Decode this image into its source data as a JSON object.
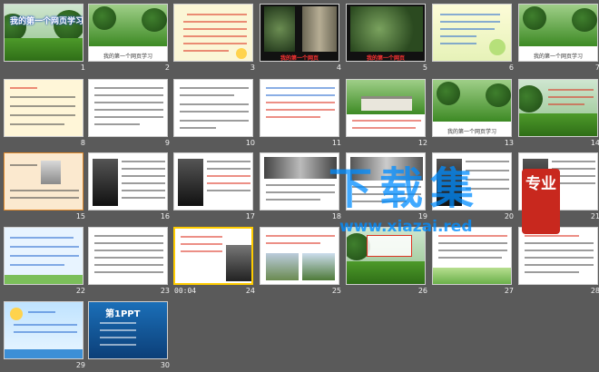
{
  "slides": [
    {
      "n": "1",
      "title": "我的第一个网页学习"
    },
    {
      "n": "2",
      "caption": "我的第一个网页学习"
    },
    {
      "n": "3"
    },
    {
      "n": "4",
      "caption": "我的第一个网页"
    },
    {
      "n": "5",
      "caption": "我的第一个网页"
    },
    {
      "n": "6"
    },
    {
      "n": "7",
      "caption": "我的第一个网页学习"
    },
    {
      "n": "8"
    },
    {
      "n": "9"
    },
    {
      "n": "10"
    },
    {
      "n": "11"
    },
    {
      "n": "12"
    },
    {
      "n": "13",
      "caption": "我的第一个网页学习"
    },
    {
      "n": "14"
    },
    {
      "n": "15"
    },
    {
      "n": "16"
    },
    {
      "n": "17"
    },
    {
      "n": "18"
    },
    {
      "n": "19"
    },
    {
      "n": "20"
    },
    {
      "n": "21"
    },
    {
      "n": "22"
    },
    {
      "n": "23"
    },
    {
      "n": "24",
      "duration": "00:04"
    },
    {
      "n": "25"
    },
    {
      "n": "26"
    },
    {
      "n": "27"
    },
    {
      "n": "28"
    },
    {
      "n": "29"
    },
    {
      "n": "30",
      "logo": "第1PPT"
    }
  ],
  "watermark": {
    "text": "下载集",
    "url": "www.xiazai.red",
    "seal": "专业"
  },
  "colors": {
    "background": "#5a5a5a",
    "selection": "#ffcc00",
    "watermark": "#008cff",
    "seal": "#c8281e"
  }
}
